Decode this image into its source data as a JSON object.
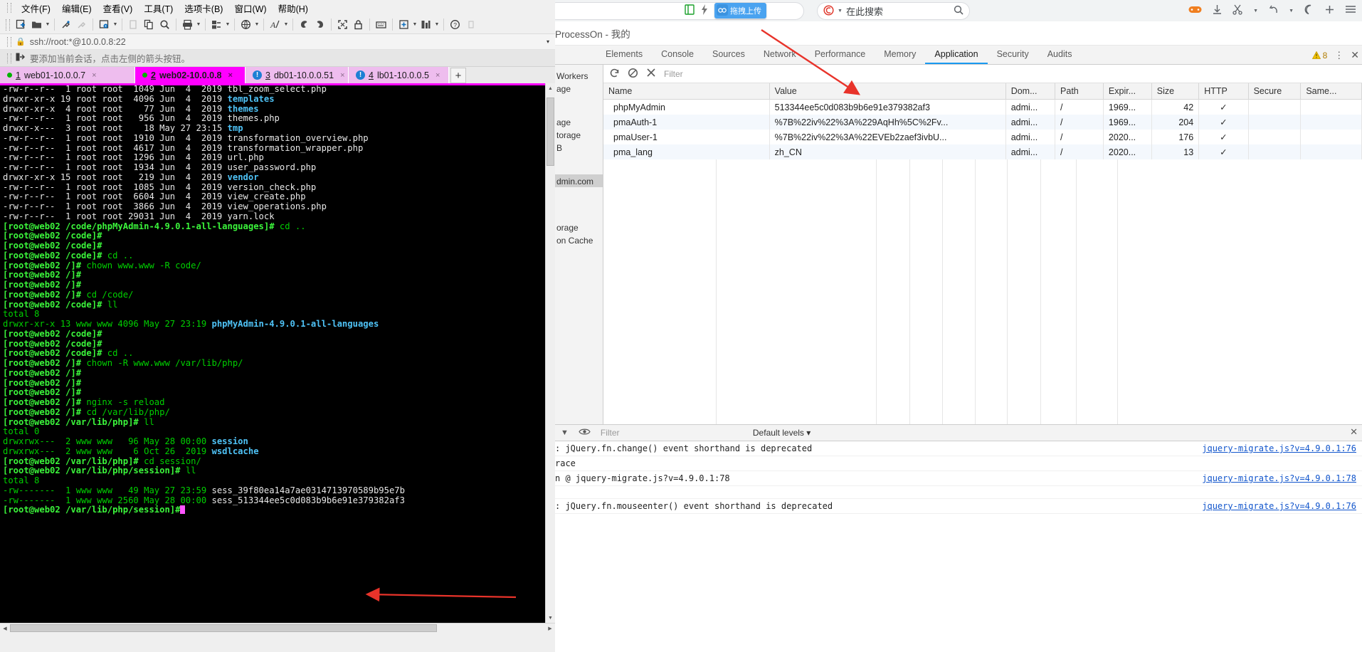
{
  "terminal_app": {
    "menus": [
      {
        "label": "文件(F)",
        "name": "menu-file"
      },
      {
        "label": "编辑(E)",
        "name": "menu-edit"
      },
      {
        "label": "查看(V)",
        "name": "menu-view"
      },
      {
        "label": "工具(T)",
        "name": "menu-tools"
      },
      {
        "label": "选项卡(B)",
        "name": "menu-tabs"
      },
      {
        "label": "窗口(W)",
        "name": "menu-window"
      },
      {
        "label": "帮助(H)",
        "name": "menu-help"
      }
    ],
    "address": {
      "lock_icon": "lock-icon",
      "value": "ssh://root:*@10.0.0.8:22",
      "caret": "▾"
    },
    "hint": {
      "icon": "add-session-icon",
      "text": "要添加当前会话，点击左侧的箭头按钮。"
    },
    "tabs": [
      {
        "num": "1",
        "label": "web01-10.0.0.7",
        "status": "ok",
        "active": false,
        "close": "×"
      },
      {
        "num": "2",
        "label": "web02-10.0.0.8",
        "status": "ok",
        "active": true,
        "close": "×"
      },
      {
        "num": "3",
        "label": "db01-10.0.0.51",
        "status": "warn",
        "active": false,
        "close": "×"
      },
      {
        "num": "4",
        "label": "lb01-10.0.0.5",
        "status": "warn",
        "active": false,
        "close": "×"
      }
    ],
    "tab_add_label": "+",
    "tab_nav": {
      "prev": "◀",
      "next": "▶",
      "menu": "▾"
    },
    "terminal_lines": [
      {
        "t": "ls",
        "perm": "-rw-r--r--",
        "links": "1",
        "owner": "root",
        "group": "root",
        "size": "1049",
        "mon": "Jun",
        "day": "4",
        "time": "2019",
        "file": "tbl_zoom_select.php",
        "cls": "w"
      },
      {
        "t": "ls",
        "perm": "drwxr-xr-x",
        "links": "19",
        "owner": "root",
        "group": "root",
        "size": "4096",
        "mon": "Jun",
        "day": "4",
        "time": "2019",
        "file": "templates",
        "cls": "b"
      },
      {
        "t": "ls",
        "perm": "drwxr-xr-x",
        "links": "4",
        "owner": "root",
        "group": "root",
        "size": "77",
        "mon": "Jun",
        "day": "4",
        "time": "2019",
        "file": "themes",
        "cls": "b"
      },
      {
        "t": "ls",
        "perm": "-rw-r--r--",
        "links": "1",
        "owner": "root",
        "group": "root",
        "size": "956",
        "mon": "Jun",
        "day": "4",
        "time": "2019",
        "file": "themes.php",
        "cls": "w"
      },
      {
        "t": "ls",
        "perm": "drwxr-x---",
        "links": "3",
        "owner": "root",
        "group": "root",
        "size": "18",
        "mon": "May",
        "day": "27",
        "time": "23:15",
        "file": "tmp",
        "cls": "b"
      },
      {
        "t": "ls",
        "perm": "-rw-r--r--",
        "links": "1",
        "owner": "root",
        "group": "root",
        "size": "1910",
        "mon": "Jun",
        "day": "4",
        "time": "2019",
        "file": "transformation_overview.php",
        "cls": "w"
      },
      {
        "t": "ls",
        "perm": "-rw-r--r--",
        "links": "1",
        "owner": "root",
        "group": "root",
        "size": "4617",
        "mon": "Jun",
        "day": "4",
        "time": "2019",
        "file": "transformation_wrapper.php",
        "cls": "w"
      },
      {
        "t": "ls",
        "perm": "-rw-r--r--",
        "links": "1",
        "owner": "root",
        "group": "root",
        "size": "1296",
        "mon": "Jun",
        "day": "4",
        "time": "2019",
        "file": "url.php",
        "cls": "w"
      },
      {
        "t": "ls",
        "perm": "-rw-r--r--",
        "links": "1",
        "owner": "root",
        "group": "root",
        "size": "1934",
        "mon": "Jun",
        "day": "4",
        "time": "2019",
        "file": "user_password.php",
        "cls": "w"
      },
      {
        "t": "ls",
        "perm": "drwxr-xr-x",
        "links": "15",
        "owner": "root",
        "group": "root",
        "size": "219",
        "mon": "Jun",
        "day": "4",
        "time": "2019",
        "file": "vendor",
        "cls": "b"
      },
      {
        "t": "ls",
        "perm": "-rw-r--r--",
        "links": "1",
        "owner": "root",
        "group": "root",
        "size": "1085",
        "mon": "Jun",
        "day": "4",
        "time": "2019",
        "file": "version_check.php",
        "cls": "w"
      },
      {
        "t": "ls",
        "perm": "-rw-r--r--",
        "links": "1",
        "owner": "root",
        "group": "root",
        "size": "6604",
        "mon": "Jun",
        "day": "4",
        "time": "2019",
        "file": "view_create.php",
        "cls": "w"
      },
      {
        "t": "ls",
        "perm": "-rw-r--r--",
        "links": "1",
        "owner": "root",
        "group": "root",
        "size": "3866",
        "mon": "Jun",
        "day": "4",
        "time": "2019",
        "file": "view_operations.php",
        "cls": "w"
      },
      {
        "t": "ls",
        "perm": "-rw-r--r--",
        "links": "1",
        "owner": "root",
        "group": "root",
        "size": "29031",
        "mon": "Jun",
        "day": "4",
        "time": "2019",
        "file": "yarn.lock",
        "cls": "w"
      },
      {
        "t": "prompt",
        "prompt": "[root@web02 /code/phpMyAdmin-4.9.0.1-all-languages]#",
        "cmd": " cd .."
      },
      {
        "t": "prompt",
        "prompt": "[root@web02 /code]#",
        "cmd": ""
      },
      {
        "t": "prompt",
        "prompt": "[root@web02 /code]#",
        "cmd": ""
      },
      {
        "t": "prompt",
        "prompt": "[root@web02 /code]#",
        "cmd": " cd .."
      },
      {
        "t": "prompt",
        "prompt": "[root@web02 /]#",
        "cmd": " chown www.www -R code/"
      },
      {
        "t": "prompt",
        "prompt": "[root@web02 /]#",
        "cmd": ""
      },
      {
        "t": "prompt",
        "prompt": "[root@web02 /]#",
        "cmd": ""
      },
      {
        "t": "prompt",
        "prompt": "[root@web02 /]#",
        "cmd": " cd /code/"
      },
      {
        "t": "prompt",
        "prompt": "[root@web02 /code]#",
        "cmd": " ll"
      },
      {
        "t": "plain",
        "text": "total 8",
        "cls": "g"
      },
      {
        "t": "ls",
        "perm": "drwxr-xr-x",
        "links": "13",
        "owner": "www",
        "group": "www",
        "size": "4096",
        "mon": "May",
        "day": "27",
        "time": "23:19",
        "file": "phpMyAdmin-4.9.0.1-all-languages",
        "cls": "b",
        "green": true
      },
      {
        "t": "prompt",
        "prompt": "[root@web02 /code]#",
        "cmd": ""
      },
      {
        "t": "prompt",
        "prompt": "[root@web02 /code]#",
        "cmd": ""
      },
      {
        "t": "prompt",
        "prompt": "[root@web02 /code]#",
        "cmd": " cd .."
      },
      {
        "t": "prompt",
        "prompt": "[root@web02 /]#",
        "cmd": " chown -R www.www /var/lib/php/"
      },
      {
        "t": "prompt",
        "prompt": "[root@web02 /]#",
        "cmd": ""
      },
      {
        "t": "prompt",
        "prompt": "[root@web02 /]#",
        "cmd": ""
      },
      {
        "t": "prompt",
        "prompt": "[root@web02 /]#",
        "cmd": ""
      },
      {
        "t": "prompt",
        "prompt": "[root@web02 /]#",
        "cmd": " nginx -s reload"
      },
      {
        "t": "prompt",
        "prompt": "[root@web02 /]#",
        "cmd": " cd /var/lib/php/"
      },
      {
        "t": "prompt",
        "prompt": "[root@web02 /var/lib/php]#",
        "cmd": " ll"
      },
      {
        "t": "plain",
        "text": "total 0",
        "cls": "g"
      },
      {
        "t": "ls",
        "perm": "drwxrwx---",
        "links": "2",
        "owner": "www",
        "group": "www",
        "size": "96",
        "mon": "May",
        "day": "28",
        "time": "00:00",
        "file": "session",
        "cls": "b",
        "green": true
      },
      {
        "t": "ls",
        "perm": "drwxrwx---",
        "links": "2",
        "owner": "www",
        "group": "www",
        "size": "6",
        "mon": "Oct",
        "day": "26",
        "time": "2019",
        "file": "wsdlcache",
        "cls": "b",
        "green": true
      },
      {
        "t": "prompt",
        "prompt": "[root@web02 /var/lib/php]#",
        "cmd": " cd session/"
      },
      {
        "t": "prompt",
        "prompt": "[root@web02 /var/lib/php/session]#",
        "cmd": " ll"
      },
      {
        "t": "plain",
        "text": "total 8",
        "cls": "g"
      },
      {
        "t": "ls",
        "perm": "-rw-------",
        "links": "1",
        "owner": "www",
        "group": "www",
        "size": "49",
        "mon": "May",
        "day": "27",
        "time": "23:59",
        "file": "sess_39f80ea14a7ae0314713970589b95e7b",
        "cls": "w",
        "green": true
      },
      {
        "t": "ls",
        "perm": "-rw-------",
        "links": "1",
        "owner": "www",
        "group": "www",
        "size": "2560",
        "mon": "May",
        "day": "28",
        "time": "00:00",
        "file": "sess_513344ee5c0d083b9b6e91e379382af3",
        "cls": "w",
        "green": true
      },
      {
        "t": "prompt",
        "prompt": "[root@web02 /var/lib/php/session]#",
        "cmd": "",
        "cursor": true
      }
    ]
  },
  "browser": {
    "upload_badge": "拖拽上传",
    "search_placeholder": "在此搜索",
    "search_engine_icon": "sogou-icon",
    "page_title": "ProcessOn - 我的",
    "toolbar_icons": [
      "book-icon",
      "lightning-icon",
      "upload-cloud-icon"
    ],
    "right_icons": [
      "gamepad-icon",
      "download-icon",
      "scissors-icon",
      "undo-icon",
      "moon-icon",
      "plus-icon",
      "menu-icon"
    ]
  },
  "devtools": {
    "tabs": [
      {
        "label": "Elements",
        "active": false
      },
      {
        "label": "Console",
        "active": false
      },
      {
        "label": "Sources",
        "active": false
      },
      {
        "label": "Network",
        "active": false
      },
      {
        "label": "Performance",
        "active": false
      },
      {
        "label": "Memory",
        "active": false
      },
      {
        "label": "Application",
        "active": true
      },
      {
        "label": "Security",
        "active": false
      },
      {
        "label": "Audits",
        "active": false
      }
    ],
    "warning_count": "8",
    "kebab": "⋮",
    "close": "✕",
    "sidebar_items": [
      {
        "label": "Workers",
        "sel": false
      },
      {
        "label": "age",
        "sel": false
      },
      {
        "label": "",
        "sel": false
      },
      {
        "label": "age",
        "sel": false
      },
      {
        "label": "torage",
        "sel": false
      },
      {
        "label": "B",
        "sel": false
      },
      {
        "label": "",
        "sel": false
      },
      {
        "label": "dmin.com",
        "sel": true
      },
      {
        "label": "",
        "sel": false
      },
      {
        "label": "",
        "sel": false
      },
      {
        "label": "orage",
        "sel": false
      },
      {
        "label": "on Cache",
        "sel": false
      }
    ],
    "cookie_toolbar": {
      "refresh_icon": "refresh-icon",
      "clear_icon": "clear-all-icon",
      "delete_icon": "delete-icon",
      "filter_placeholder": "Filter"
    },
    "cookie_table": {
      "headers": [
        "Name",
        "Value",
        "Dom...",
        "Path",
        "Expir...",
        "Size",
        "HTTP",
        "Secure",
        "Same..."
      ],
      "rows": [
        {
          "name": "phpMyAdmin",
          "value": "513344ee5c0d083b9b6e91e379382af3",
          "domain": "admi...",
          "path": "/",
          "expires": "1969...",
          "size": "42",
          "http": "✓",
          "secure": "",
          "samesite": ""
        },
        {
          "name": "pmaAuth-1",
          "value": "%7B%22iv%22%3A%229AqHh%5C%2Fv...",
          "domain": "admi...",
          "path": "/",
          "expires": "1969...",
          "size": "204",
          "http": "✓",
          "secure": "",
          "samesite": ""
        },
        {
          "name": "pmaUser-1",
          "value": "%7B%22iv%22%3A%22EVEb2zaef3ivbU...",
          "domain": "admi...",
          "path": "/",
          "expires": "2020...",
          "size": "176",
          "http": "✓",
          "secure": "",
          "samesite": ""
        },
        {
          "name": "pma_lang",
          "value": "zh_CN",
          "domain": "admi...",
          "path": "/",
          "expires": "2020...",
          "size": "13",
          "http": "✓",
          "secure": "",
          "samesite": ""
        }
      ]
    },
    "drawer": {
      "filter_placeholder": "Filter",
      "levels_label": "Default levels ▾",
      "eye_icon": "eye-icon",
      "funnel_icon": "funnel-icon",
      "close_icon": "✕"
    },
    "console_rows": [
      {
        "msg": ": jQuery.fn.change() event shorthand is deprecated",
        "src": "jquery-migrate.js?v=4.9.0.1:76",
        "warn": false
      },
      {
        "msg": "race",
        "src": "",
        "warn": false
      },
      {
        "msg": "n @ jquery-migrate.js?v=4.9.0.1:78",
        "src": "jquery-migrate.js?v=4.9.0.1:78",
        "warn": false
      },
      {
        "msg": "",
        "src": "",
        "warn": false
      },
      {
        "msg": ": jQuery.fn.mouseenter() event shorthand is deprecated",
        "src": "jquery-migrate.js?v=4.9.0.1:76",
        "warn": false
      }
    ]
  },
  "colors": {
    "tab_active": "#ff00ff",
    "tab_inactive": "#eebdee",
    "devtools_accent": "#1a9af0",
    "annotation_arrow": "#e8332a",
    "terminal_bg": "#000000",
    "terminal_green": "#00d000",
    "terminal_blue": "#4fc3f7"
  }
}
